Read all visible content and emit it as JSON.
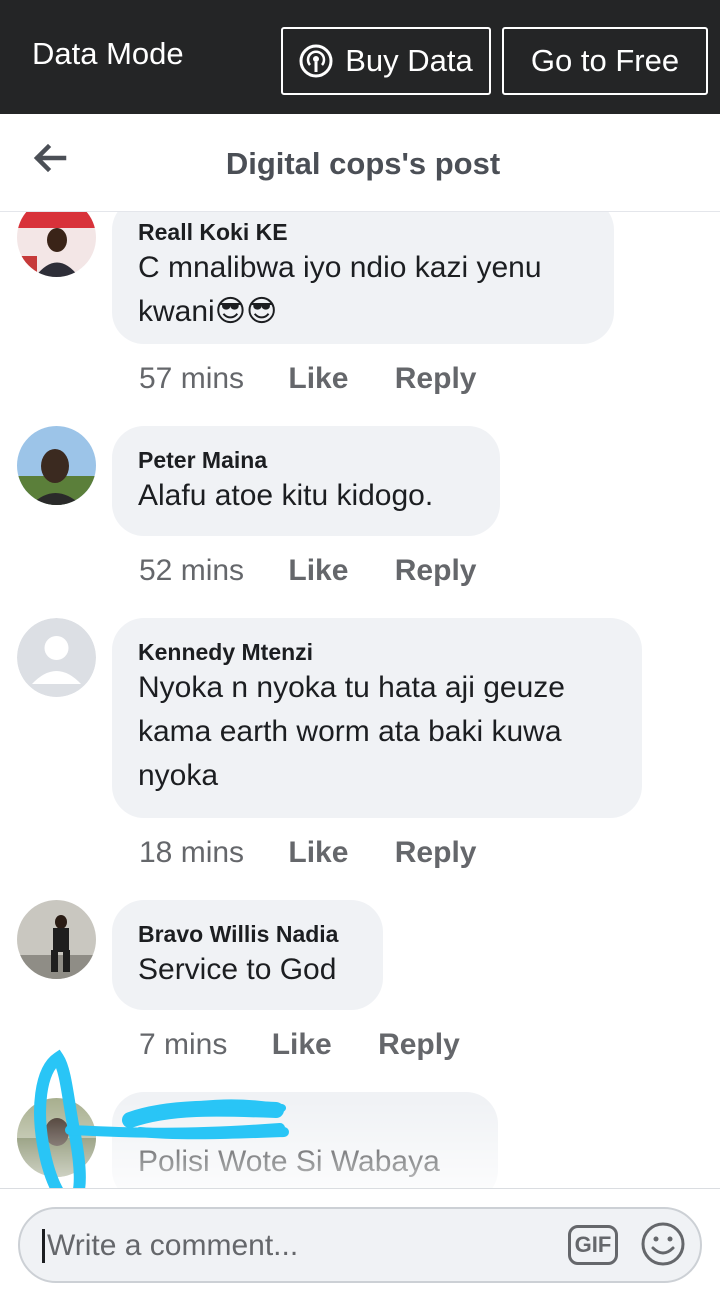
{
  "databar": {
    "mode_label": "Data Mode",
    "buy_label": "Buy Data",
    "free_label": "Go to Free"
  },
  "header": {
    "title": "Digital cops's post"
  },
  "comments": [
    {
      "author": "Reall Koki KE",
      "lines": [
        "C mnalibwa iyo ndio kazi yenu",
        "kwani😎😎"
      ],
      "time": "57 mins",
      "like": "Like",
      "reply": "Reply"
    },
    {
      "author": "Peter Maina",
      "lines": [
        "Alafu atoe kitu kidogo."
      ],
      "time": "52 mins",
      "like": "Like",
      "reply": "Reply"
    },
    {
      "author": "Kennedy Mtenzi",
      "lines": [
        "Nyoka n nyoka tu hata aji geuze",
        "kama earth worm ata baki kuwa",
        "nyoka"
      ],
      "time": "18 mins",
      "like": "Like",
      "reply": "Reply"
    },
    {
      "author": "Bravo Willis Nadia",
      "lines": [
        "Service to God"
      ],
      "time": "7 mins",
      "like": "Like",
      "reply": "Reply"
    },
    {
      "author": "",
      "lines": [
        "Polisi Wote Si Wabaya"
      ]
    }
  ],
  "composer": {
    "placeholder": "Write a comment...",
    "gif_label": "GIF"
  },
  "colors": {
    "databar_bg": "#242526",
    "bubble_bg": "#f0f2f5",
    "meta_text": "#65676b",
    "scribble": "#29c5f6"
  }
}
